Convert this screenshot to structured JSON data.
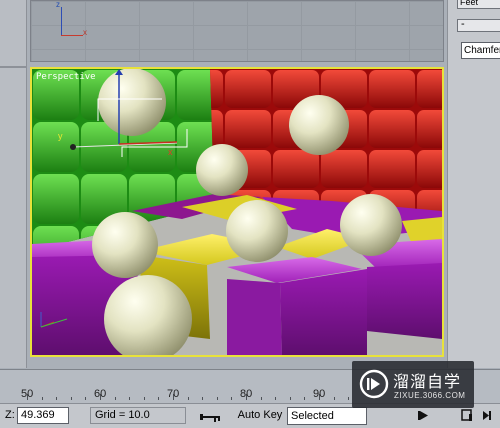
{
  "top_viewport": {
    "axis_z": "z",
    "axis_x": "x"
  },
  "perspective_viewport": {
    "label": "Perspective"
  },
  "right_panel": {
    "partial_field": "Feet",
    "collapse_symbol": "-",
    "modifier_list_value": "Chamfer"
  },
  "timeline": {
    "ticks": [
      "50",
      "60",
      "70",
      "80",
      "90"
    ]
  },
  "status_bar": {
    "z_label": "Z:",
    "z_value": "49.369",
    "grid_label": "Grid = 10.0",
    "auto_key_label": "Auto Key",
    "selection_dropdown_value": "Selected"
  },
  "watermark": {
    "title": "溜溜自学",
    "url": "ZIXUE.3066.COM"
  },
  "colors": {
    "viewport_border_active": "#e8e23a",
    "green_box": "#2fa81f",
    "red_box": "#c81212",
    "purple_box": "#a01ab8",
    "yellow_box": "#d4c81e",
    "sphere": "#e3e3c2"
  },
  "icons": [
    "key-icon",
    "play-button-icon",
    "next-frame-icon",
    "watermark-logo-icon"
  ]
}
